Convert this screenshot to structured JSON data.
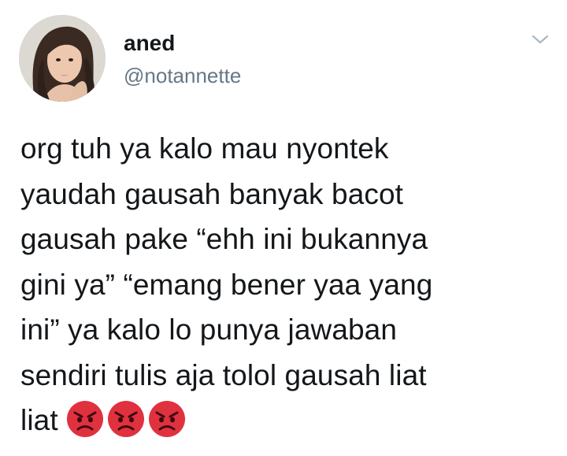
{
  "user": {
    "display_name": "aned",
    "handle": "@notannette"
  },
  "tweet": {
    "lines": [
      "org tuh ya kalo mau nyontek",
      "yaudah gausah banyak bacot",
      "gausah pake “ehh ini bukannya",
      "gini ya” “emang bener yaa yang",
      "ini” ya kalo lo punya jawaban",
      "sendiri tulis aja tolol gausah liat",
      "liat"
    ],
    "emojis": [
      "angry-face-emoji",
      "angry-face-emoji",
      "angry-face-emoji"
    ]
  },
  "icons": {
    "menu": "chevron-down-icon"
  },
  "colors": {
    "text": "#14171a",
    "secondary_text": "#657786",
    "chevron": "#aab8c2",
    "emoji_red": "#e0313f"
  }
}
